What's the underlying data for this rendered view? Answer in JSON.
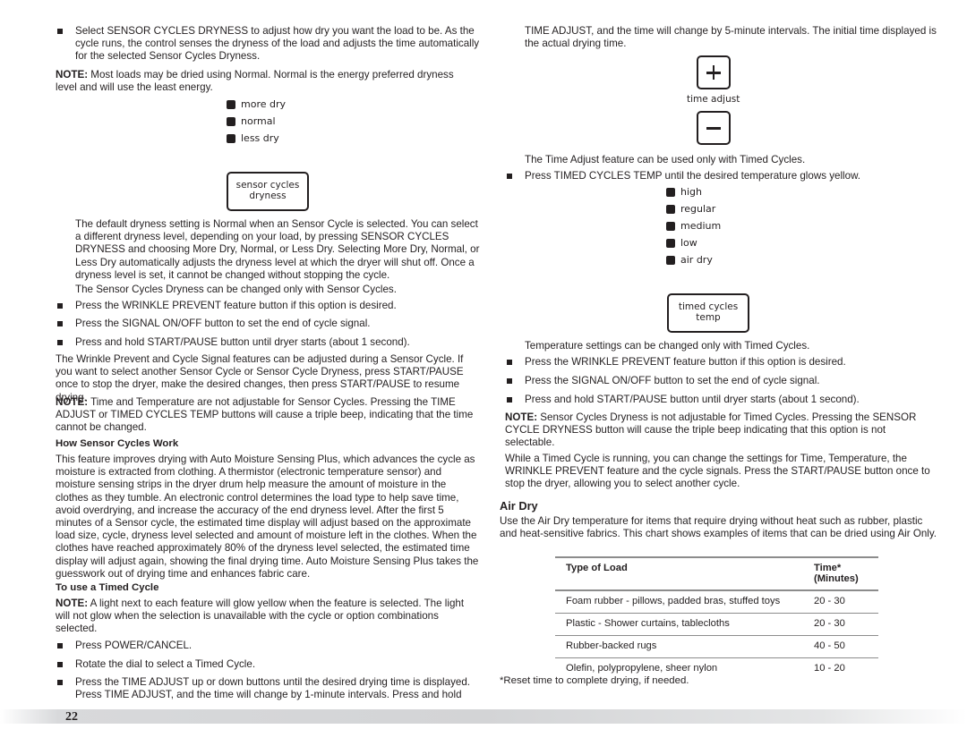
{
  "left": {
    "bullet_select_dryness": "Select SENSOR CYCLES DRYNESS to adjust how dry you want the load to be. As the cycle runs, the control senses the dryness of the load and adjusts the time automatically for the selected Sensor Cycles Dryness.",
    "note1_label": "NOTE:",
    "note1_text": " Most loads may be dried using Normal. Normal is the energy preferred dryness level and will use the least energy.",
    "dryness_lights": [
      "more dry",
      "normal",
      "less dry"
    ],
    "sensor_button_label_line1": "sensor cycles",
    "sensor_button_label_line2": "dryness",
    "default_dryness_para": "The default dryness setting is Normal when an Sensor Cycle is selected. You can select a different dryness level, depending on your load, by pressing SENSOR CYCLES DRYNESS and choosing More Dry, Normal, or Less Dry. Selecting More Dry, Normal, or Less Dry automatically adjusts the dryness level at which the dryer will shut off. Once a dryness level is set, it cannot be changed without stopping the cycle.",
    "sensor_only_para": "The Sensor Cycles Dryness can be changed only with Sensor Cycles.",
    "bullets_a": [
      "Press the WRINKLE PREVENT feature button if this option is desired.",
      "Press the SIGNAL ON/OFF button to set the end of cycle signal.",
      "Press and hold START/PAUSE button until dryer starts (about 1 second)."
    ],
    "wrinkle_para": "The Wrinkle Prevent and Cycle Signal features can be adjusted during a Sensor Cycle. If you want to select another Sensor Cycle or Sensor Cycle Dryness, press START/PAUSE once to stop the dryer, make the desired changes, then press START/PAUSE  to resume drying.",
    "note2_label": "NOTE:",
    "note2_text": " Time and Temperature are not adjustable for Sensor Cycles. Pressing the TIME ADJUST or TIMED CYCLES TEMP buttons will cause a triple beep, indicating that the time cannot be changed.",
    "how_heading": "How Sensor Cycles Work",
    "how_para": "This feature improves drying with Auto Moisture Sensing Plus, which advances the cycle as moisture is extracted from clothing. A thermistor (electronic temperature sensor) and moisture sensing strips in the dryer drum help measure the amount of moisture in the clothes as they tumble. An electronic control determines the load type to help save time, avoid overdrying, and increase the accuracy of the end dryness level. After the first 5 minutes of a Sensor cycle, the estimated time display will adjust based on the approximate load size, cycle, dryness level selected and amount of moisture left in the clothes. When the clothes have reached approximately 80% of the dryness level selected, the estimated time display will adjust again, showing the final drying time. Auto Moisture Sensing Plus takes the guesswork out of drying time and enhances fabric care.",
    "timed_heading": "To use a Timed Cycle",
    "note3_label": "NOTE:",
    "note3_text": " A light next to each feature will glow yellow when the feature is selected. The light will not glow when the selection is unavailable with the cycle or option combinations selected.",
    "bullets_b": [
      "Press POWER/CANCEL.",
      "Rotate the dial to select a Timed Cycle.",
      "Press the TIME ADJUST up or down buttons until the desired drying time is displayed. Press TIME ADJUST, and the time will change by 1-minute intervals. Press and hold"
    ]
  },
  "right": {
    "continued_para": "TIME ADJUST, and the time will change by 5-minute intervals. The initial time displayed is the actual drying time.",
    "time_adjust_caption": "time adjust",
    "time_adjust_only_para": "The Time Adjust feature can be used only with Timed Cycles.",
    "bullet_temp": "Press TIMED CYCLES TEMP until the desired temperature glows yellow.",
    "temp_lights": [
      "high",
      "regular",
      "medium",
      "low",
      "air dry"
    ],
    "temp_button_label_line1": "timed cycles",
    "temp_button_label_line2": "temp",
    "temp_only_para": "Temperature settings can be changed only with Timed Cycles.",
    "bullets_c": [
      "Press the WRINKLE PREVENT feature button if this option is desired.",
      "Press the SIGNAL ON/OFF button to set the end of cycle signal.",
      "Press and hold START/PAUSE button until dryer starts (about 1 second)."
    ],
    "note4_label": "NOTE:",
    "note4_text": " Sensor Cycles Dryness is not adjustable for Timed Cycles. Pressing the SENSOR CYCLE DRYNESS button will cause the triple beep indicating that this option is not selectable.",
    "running_para": "While a Timed Cycle is running, you can change the settings for Time, Temperature, the WRINKLE PREVENT feature and the cycle signals. Press the START/PAUSE button once to stop the dryer, allowing you to select another cycle.",
    "air_dry_heading": "Air Dry",
    "air_dry_para": "Use the Air Dry temperature for items that require drying without heat such as rubber, plastic and heat-sensitive fabrics. This chart shows examples of items that can be dried using Air Only.",
    "table": {
      "headers": [
        "Type of Load",
        "Time*",
        "(Minutes)"
      ],
      "rows": [
        [
          "Foam rubber - pillows, padded bras, stuffed toys",
          "20 - 30"
        ],
        [
          "Plastic - Shower curtains, tablecloths",
          "20 - 30"
        ],
        [
          "Rubber-backed rugs",
          "40 - 50"
        ],
        [
          "Olefin, polypropylene, sheer nylon",
          "10 - 20"
        ]
      ]
    },
    "footnote": "*Reset time to complete drying, if needed."
  },
  "footer": {
    "page_number": "22"
  }
}
